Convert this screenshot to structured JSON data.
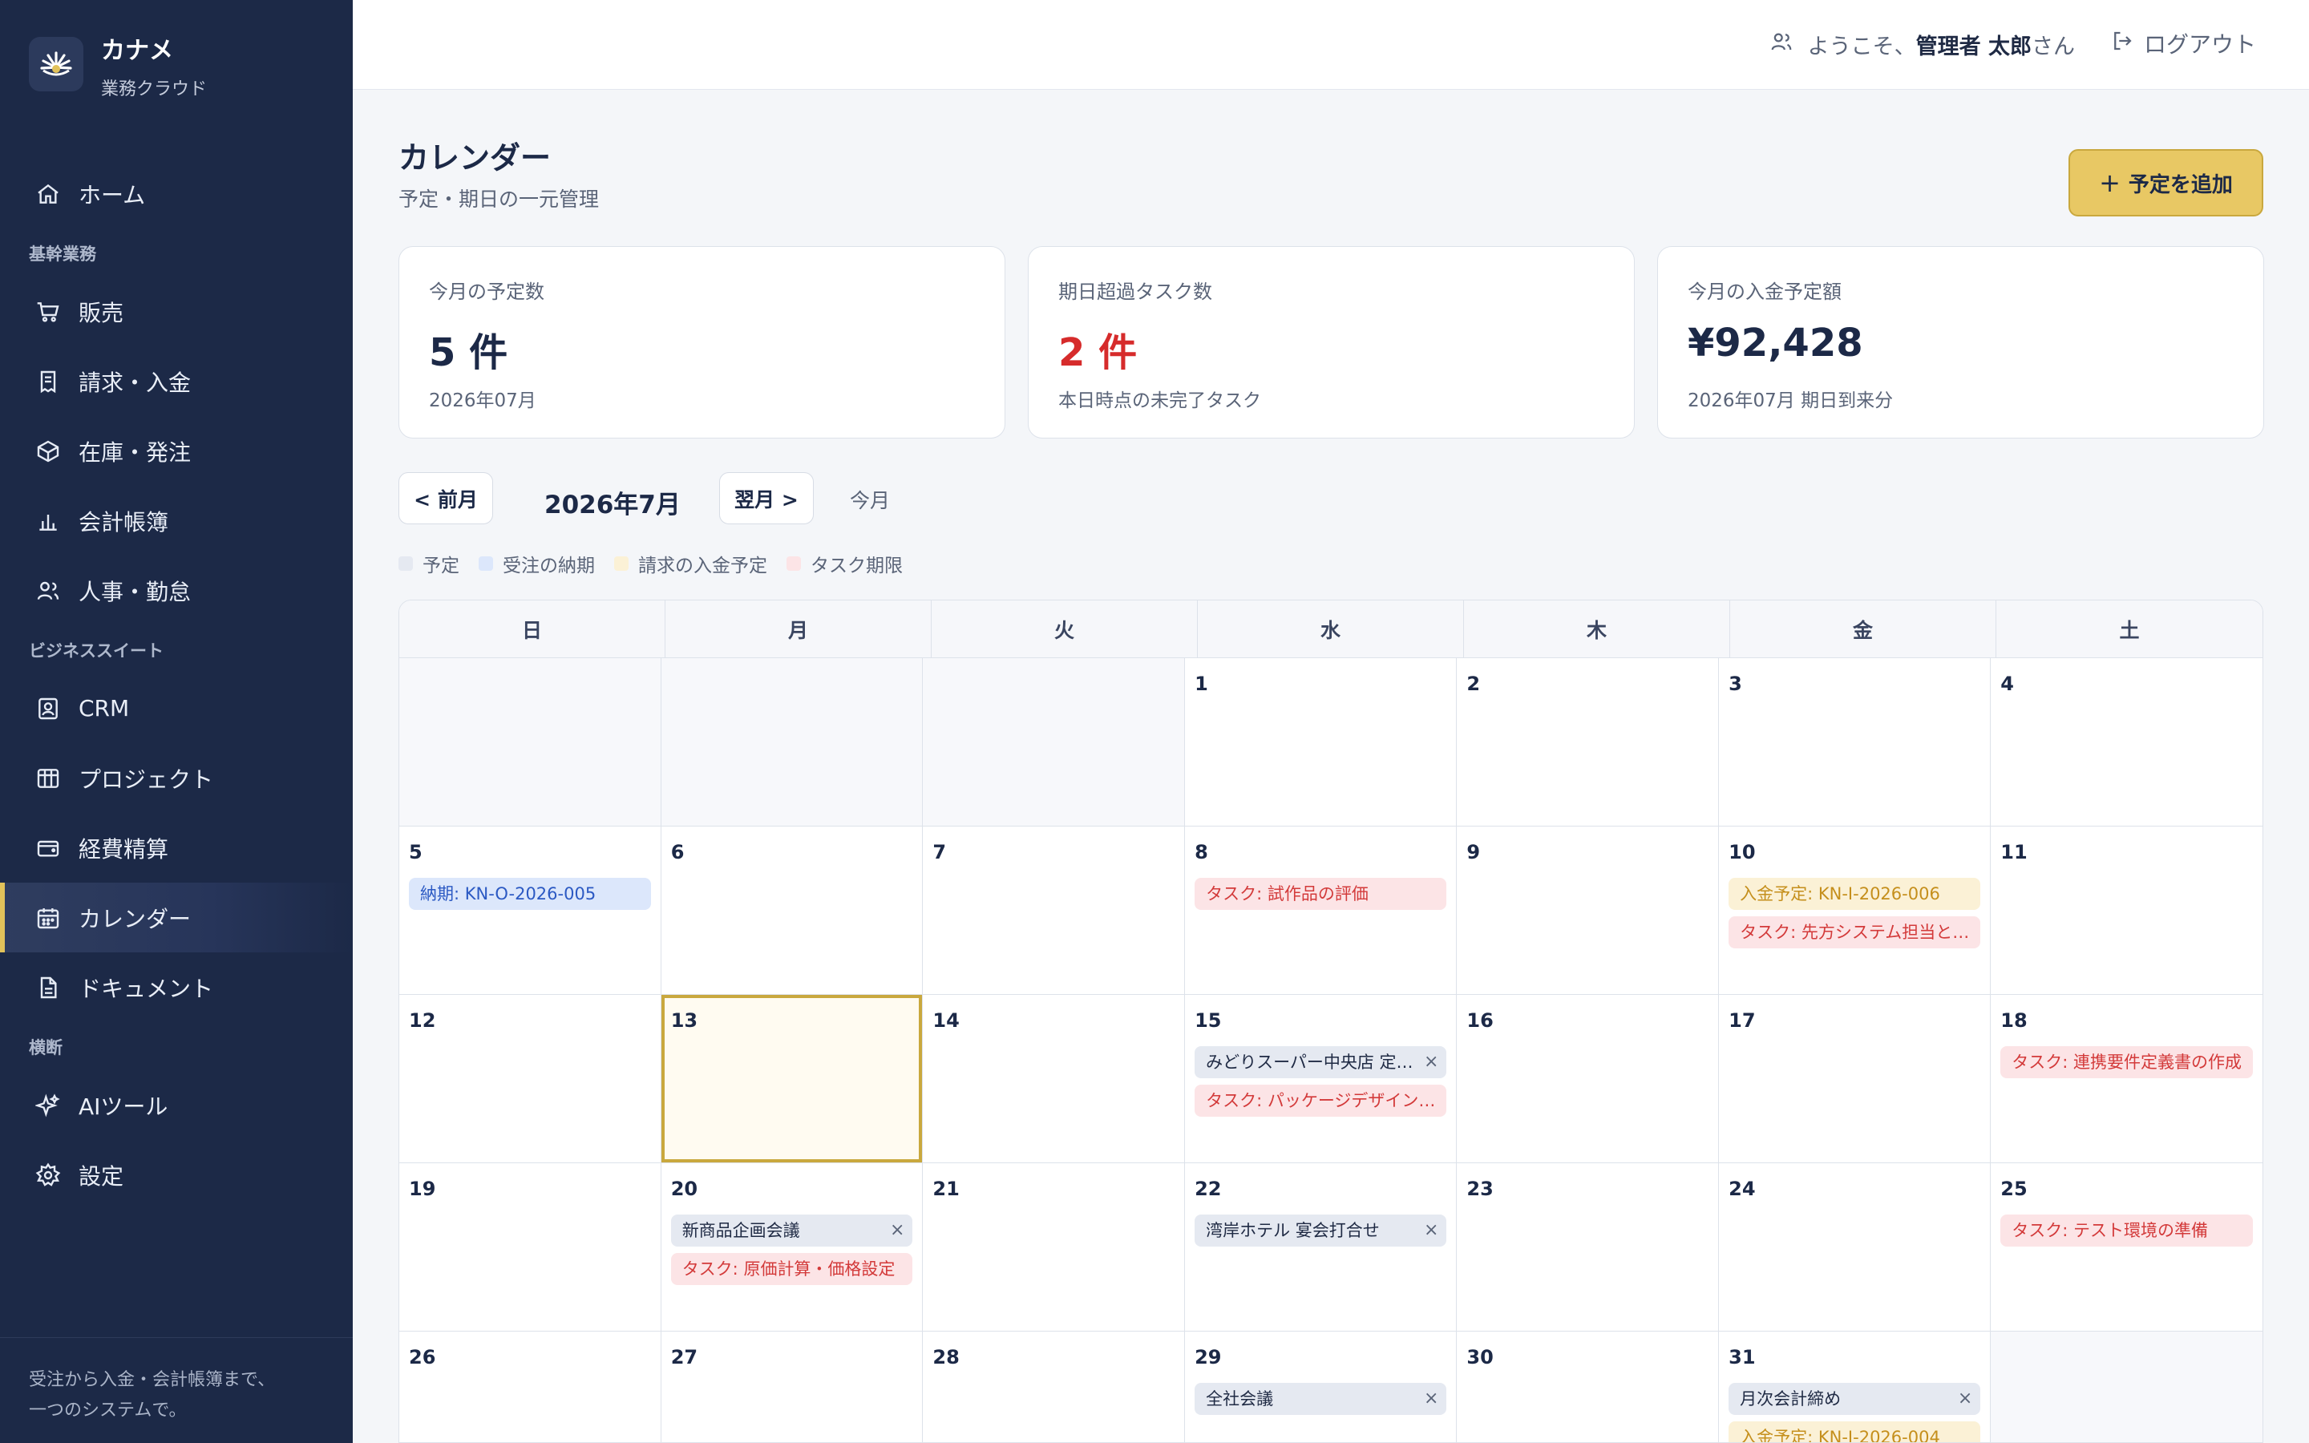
{
  "brand": {
    "name": "カナメ",
    "subtitle": "業務クラウド"
  },
  "sidebar": {
    "home": "ホーム",
    "section1": "基幹業務",
    "sales": "販売",
    "billing": "請求・入金",
    "inventory": "在庫・発注",
    "accounting": "会計帳簿",
    "hr": "人事・勤怠",
    "section2": "ビジネススイート",
    "crm": "CRM",
    "project": "プロジェクト",
    "expense": "経費精算",
    "calendar": "カレンダー",
    "document": "ドキュメント",
    "section3": "横断",
    "ai": "AIツール",
    "settings": "設定",
    "footer_line1": "受注から入金・会計帳簿まで、",
    "footer_line2": "一つのシステムで。"
  },
  "header": {
    "welcome_prefix": "ようこそ、",
    "user_name": "管理者 太郎",
    "welcome_suffix": " さん",
    "logout": "ログアウト"
  },
  "page": {
    "title": "カレンダー",
    "subtitle": "予定・期日の一元管理",
    "add_button": "予定を追加"
  },
  "stats": [
    {
      "label": "今月の予定数",
      "value": "5 件",
      "note": "2026年07月"
    },
    {
      "label": "期日超過タスク数",
      "value": "2 件",
      "note": "本日時点の未完了タスク"
    },
    {
      "label": "今月の入金予定額",
      "value": "¥92,428",
      "note": "2026年07月 期日到来分"
    }
  ],
  "month_nav": {
    "prev": "< 前月",
    "current": "2026年7月",
    "next": "翌月 >",
    "today": "今月"
  },
  "legend": {
    "event": "予定",
    "delivery": "受注の納期",
    "payment": "請求の入金予定",
    "task": "タスク期限",
    "colors": {
      "event": "#e5e9f1",
      "delivery": "#dce7fb",
      "payment": "#fbf1d6",
      "task": "#fce4e6"
    }
  },
  "calendar": {
    "weekdays": [
      "日",
      "月",
      "火",
      "水",
      "木",
      "金",
      "土"
    ],
    "days": [
      {
        "num": "",
        "events": []
      },
      {
        "num": "",
        "events": []
      },
      {
        "num": "",
        "events": []
      },
      {
        "num": "1",
        "events": []
      },
      {
        "num": "2",
        "events": []
      },
      {
        "num": "3",
        "events": []
      },
      {
        "num": "4",
        "events": []
      },
      {
        "num": "5",
        "events": [
          {
            "type": "delivery",
            "text": "納期: KN-O-2026-005"
          }
        ]
      },
      {
        "num": "6",
        "events": []
      },
      {
        "num": "7",
        "events": []
      },
      {
        "num": "8",
        "events": [
          {
            "type": "task",
            "text": "タスク: 試作品の評価"
          }
        ]
      },
      {
        "num": "9",
        "events": []
      },
      {
        "num": "10",
        "events": [
          {
            "type": "payment",
            "text": "入金予定: KN-I-2026-006"
          },
          {
            "type": "task",
            "text": "タスク: 先方システム担当と…"
          }
        ]
      },
      {
        "num": "11",
        "events": []
      },
      {
        "num": "12",
        "events": []
      },
      {
        "num": "13",
        "today": true,
        "events": []
      },
      {
        "num": "14",
        "events": []
      },
      {
        "num": "15",
        "events": [
          {
            "type": "event",
            "text": "みどりスーパー中央店 定…"
          },
          {
            "type": "task",
            "text": "タスク: パッケージデザイン…"
          }
        ]
      },
      {
        "num": "16",
        "events": []
      },
      {
        "num": "17",
        "events": []
      },
      {
        "num": "18",
        "events": [
          {
            "type": "task",
            "text": "タスク: 連携要件定義書の作成"
          }
        ]
      },
      {
        "num": "19",
        "events": []
      },
      {
        "num": "20",
        "events": [
          {
            "type": "event",
            "text": "新商品企画会議"
          },
          {
            "type": "task",
            "text": "タスク: 原価計算・価格設定"
          }
        ]
      },
      {
        "num": "21",
        "events": []
      },
      {
        "num": "22",
        "events": [
          {
            "type": "event",
            "text": "湾岸ホテル 宴会打合せ"
          }
        ]
      },
      {
        "num": "23",
        "events": []
      },
      {
        "num": "24",
        "events": []
      },
      {
        "num": "25",
        "events": [
          {
            "type": "task",
            "text": "タスク: テスト環境の準備"
          }
        ]
      },
      {
        "num": "26",
        "events": []
      },
      {
        "num": "27",
        "events": []
      },
      {
        "num": "28",
        "events": []
      },
      {
        "num": "29",
        "events": [
          {
            "type": "event",
            "text": "全社会議"
          }
        ]
      },
      {
        "num": "30",
        "events": []
      },
      {
        "num": "31",
        "events": [
          {
            "type": "event",
            "text": "月次会計締め"
          },
          {
            "type": "payment",
            "text": "入金予定: KN-I-2026-004"
          }
        ]
      },
      {
        "num": "",
        "events": []
      }
    ],
    "close_glyph": "×"
  }
}
